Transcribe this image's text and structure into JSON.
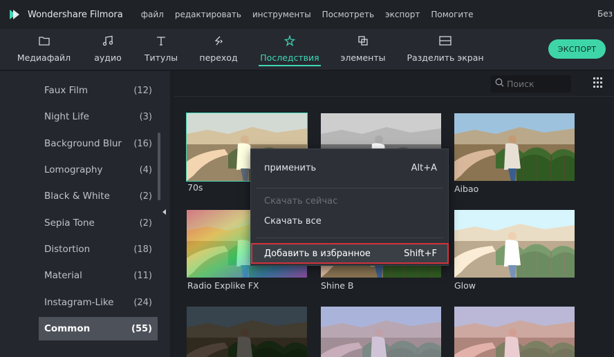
{
  "titlebar": {
    "app_title": "Wondershare Filmora",
    "menu": [
      "файл",
      "редактировать",
      "инструменты",
      "Посмотреть",
      "экспорт",
      "Помогите"
    ],
    "right_text": "Без"
  },
  "toolbar": {
    "tools": [
      {
        "label": "Медиафайл",
        "icon": "folder-icon"
      },
      {
        "label": "аудио",
        "icon": "music-note-icon"
      },
      {
        "label": "Титулы",
        "icon": "text-t-icon"
      },
      {
        "label": "переход",
        "icon": "transition-icon"
      },
      {
        "label": "Последствия",
        "icon": "effects-sparkle-icon"
      },
      {
        "label": "элементы",
        "icon": "elements-icon"
      },
      {
        "label": "Разделить экран",
        "icon": "split-screen-icon"
      }
    ],
    "active_tool": "Последствия",
    "export_label": "ЭКСПОРТ",
    "accent": "#3fd6b5"
  },
  "sidebar": {
    "items": [
      {
        "name": "Faux Film",
        "count": "(12)"
      },
      {
        "name": "Night Life",
        "count": "(3)"
      },
      {
        "name": "Background Blur",
        "count": "(16)"
      },
      {
        "name": "Lomography",
        "count": "(4)"
      },
      {
        "name": "Black & White",
        "count": "(2)"
      },
      {
        "name": "Sepia Tone",
        "count": "(2)"
      },
      {
        "name": "Distortion",
        "count": "(18)"
      },
      {
        "name": "Material",
        "count": "(11)"
      },
      {
        "name": "Instagram-Like",
        "count": "(24)"
      },
      {
        "name": "Common",
        "count": "(55)"
      }
    ],
    "selected": "Common"
  },
  "content": {
    "search_placeholder": "Поиск",
    "thumbnails": [
      {
        "label": "70s",
        "style": "warm-faded",
        "selected": true
      },
      {
        "label": "",
        "style": "black-white"
      },
      {
        "label": "Aibao",
        "style": "natural"
      },
      {
        "label": "Radio Explike FX",
        "style": "rainbow"
      },
      {
        "label": "Shine B",
        "style": "natural"
      },
      {
        "label": "Glow",
        "style": "glow"
      },
      {
        "label": "",
        "style": "dark"
      },
      {
        "label": "",
        "style": "purple-haze"
      },
      {
        "label": "",
        "style": "pink"
      }
    ]
  },
  "context_menu": {
    "apply_label": "применить",
    "apply_shortcut": "Alt+A",
    "download_now_label": "Скачать сейчас",
    "download_all_label": "Скачать все",
    "favorite_label": "Добавить в избранное",
    "favorite_shortcut": "Shift+F",
    "highlight_color": "#d3333b"
  }
}
